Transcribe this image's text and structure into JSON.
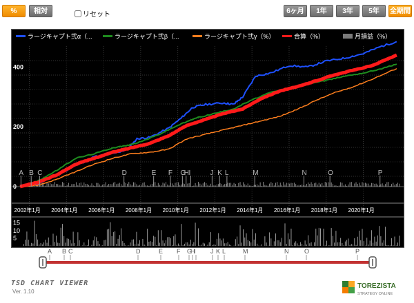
{
  "toolbar": {
    "mode_percent": "%",
    "mode_relative": "相対",
    "reset_label": "リセット",
    "periods": [
      "6ヶ月",
      "1年",
      "3年",
      "5年",
      "全期間"
    ],
    "active_period": "全期間"
  },
  "legend": [
    {
      "label": "ラージキャプト弐α（...",
      "color": "#1e50ff"
    },
    {
      "label": "ラージキャプト弐β（...",
      "color": "#1e8c1e"
    },
    {
      "label": "ラージキャプト弐γ（%）",
      "color": "#ff7f1e"
    },
    {
      "label": "合算（%）",
      "color": "#ff1a1a"
    },
    {
      "label": "月損益（%）",
      "color": "#7a7a7a"
    }
  ],
  "chart_data": {
    "type": "line",
    "y_ticks": [
      "400",
      "200",
      "0"
    ],
    "ylim": [
      0,
      470
    ],
    "x_ticks": [
      "2002年1月",
      "2004年1月",
      "2006年1月",
      "2008年1月",
      "2010年1月",
      "2012年1月",
      "2014年1月",
      "2016年1月",
      "2018年1月",
      "2020年1月"
    ],
    "event_markers": [
      "A",
      "B",
      "C",
      "D",
      "E",
      "F",
      "G",
      "H",
      "I",
      "J",
      "K",
      "L",
      "M",
      "N",
      "O",
      "P"
    ],
    "series": [
      {
        "name": "ラージキャプト弐α（...",
        "color": "#1e50ff",
        "x": [
          2001.5,
          2002.5,
          2003.5,
          2004.5,
          2005.5,
          2006.5,
          2007.3,
          2007.8,
          2008.5,
          2009.5,
          2010.2,
          2010.8,
          2011.5,
          2012.5,
          2013.0,
          2013.5,
          2014.2,
          2015.0,
          2016.0,
          2017.0,
          2018.0,
          2019.0,
          2020.0,
          2021.0,
          2021.8
        ],
        "values": [
          0,
          10,
          40,
          70,
          100,
          110,
          125,
          160,
          165,
          195,
          230,
          265,
          275,
          280,
          275,
          300,
          370,
          380,
          405,
          400,
          420,
          430,
          445,
          470,
          485
        ]
      },
      {
        "name": "ラージキャプト弐β（...",
        "color": "#1e8c1e",
        "x": [
          2001.5,
          2002.5,
          2003.5,
          2004.5,
          2005.5,
          2006.5,
          2007.3,
          2008.0,
          2009.0,
          2010.0,
          2011.0,
          2012.0,
          2013.0,
          2014.0,
          2015.0,
          2016.0,
          2017.0,
          2018.0,
          2019.0,
          2020.0,
          2021.0,
          2021.8
        ],
        "values": [
          0,
          20,
          55,
          95,
          110,
          130,
          138,
          150,
          175,
          205,
          230,
          245,
          260,
          290,
          315,
          330,
          345,
          355,
          370,
          380,
          395,
          410
        ]
      },
      {
        "name": "ラージキャプト弐γ（%）",
        "color": "#ff7f1e",
        "x": [
          2001.5,
          2002.5,
          2003.5,
          2004.5,
          2005.5,
          2006.5,
          2007.5,
          2008.5,
          2009.5,
          2010.5,
          2011.5,
          2012.5,
          2013.5,
          2014.5,
          2015.5,
          2016.5,
          2017.5,
          2018.5,
          2019.5,
          2020.5,
          2021.8
        ],
        "values": [
          0,
          5,
          25,
          50,
          75,
          95,
          110,
          115,
          125,
          160,
          175,
          190,
          205,
          220,
          235,
          260,
          290,
          315,
          335,
          360,
          395
        ]
      },
      {
        "name": "合算（%）",
        "color": "#ff1a1a",
        "x": [
          2001.5,
          2002.5,
          2003.5,
          2004.5,
          2005.5,
          2006.5,
          2007.5,
          2008.5,
          2009.5,
          2010.5,
          2011.5,
          2012.5,
          2013.5,
          2014.5,
          2015.5,
          2016.5,
          2017.5,
          2018.5,
          2019.5,
          2020.5,
          2021.8
        ],
        "values": [
          0,
          15,
          40,
          75,
          95,
          115,
          130,
          145,
          170,
          205,
          225,
          245,
          260,
          295,
          320,
          335,
          355,
          375,
          390,
          405,
          440
        ]
      }
    ],
    "monthly_ylim": [
      0,
      18
    ],
    "monthly_ticks": [
      "15",
      "10",
      "5"
    ]
  },
  "slider": {
    "labels": [
      "A",
      "B",
      "C",
      "D",
      "E",
      "F",
      "G",
      "H",
      "I",
      "J",
      "K",
      "L",
      "M",
      "N",
      "O",
      "P"
    ]
  },
  "footer": {
    "title": "TSD CHART VIEWER",
    "version": "Ver. 1.10",
    "logo_name": "TOREZISTA",
    "logo_sub": "STRATEGY ONLINE"
  }
}
